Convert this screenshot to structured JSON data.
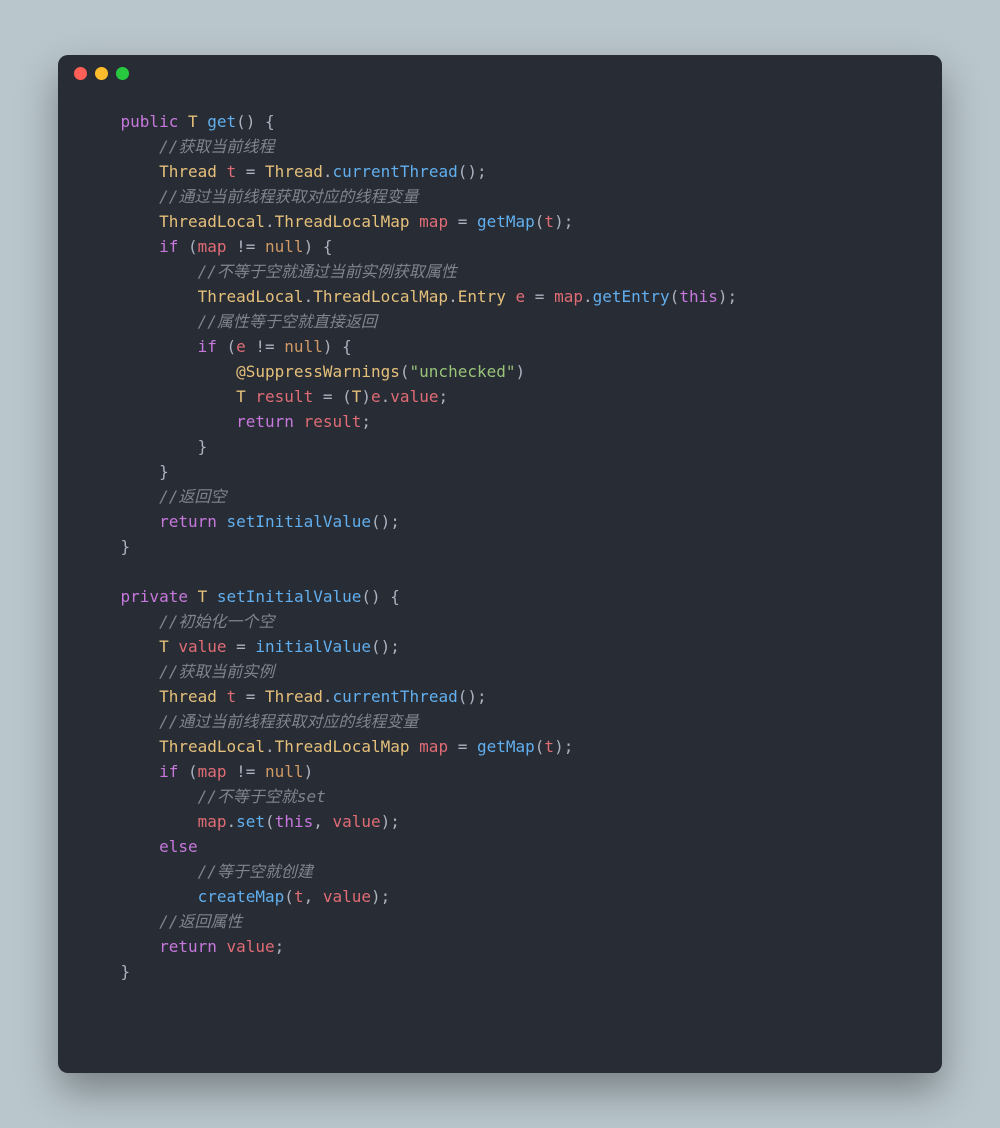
{
  "window": {
    "traffic_lights": [
      "red",
      "yellow",
      "green"
    ]
  },
  "code": {
    "lines": [
      {
        "ind": 1,
        "type": "mixed",
        "tokens": [
          {
            "c": "kw",
            "t": "public"
          },
          {
            "c": "pn",
            "t": " "
          },
          {
            "c": "type",
            "t": "T"
          },
          {
            "c": "pn",
            "t": " "
          },
          {
            "c": "fn",
            "t": "get"
          },
          {
            "c": "pn",
            "t": "() {"
          }
        ]
      },
      {
        "ind": 2,
        "type": "cmt",
        "text": "//获取当前线程"
      },
      {
        "ind": 2,
        "type": "mixed",
        "tokens": [
          {
            "c": "type",
            "t": "Thread"
          },
          {
            "c": "pn",
            "t": " "
          },
          {
            "c": "id",
            "t": "t"
          },
          {
            "c": "pn",
            "t": " = "
          },
          {
            "c": "type",
            "t": "Thread"
          },
          {
            "c": "pn",
            "t": "."
          },
          {
            "c": "fn",
            "t": "currentThread"
          },
          {
            "c": "pn",
            "t": "();"
          }
        ]
      },
      {
        "ind": 2,
        "type": "cmt",
        "text": "//通过当前线程获取对应的线程变量"
      },
      {
        "ind": 2,
        "type": "mixed",
        "tokens": [
          {
            "c": "type",
            "t": "ThreadLocal"
          },
          {
            "c": "pn",
            "t": "."
          },
          {
            "c": "type",
            "t": "ThreadLocalMap"
          },
          {
            "c": "pn",
            "t": " "
          },
          {
            "c": "id",
            "t": "map"
          },
          {
            "c": "pn",
            "t": " = "
          },
          {
            "c": "fn",
            "t": "getMap"
          },
          {
            "c": "pn",
            "t": "("
          },
          {
            "c": "id",
            "t": "t"
          },
          {
            "c": "pn",
            "t": ");"
          }
        ]
      },
      {
        "ind": 2,
        "type": "mixed",
        "tokens": [
          {
            "c": "kw",
            "t": "if"
          },
          {
            "c": "pn",
            "t": " ("
          },
          {
            "c": "id",
            "t": "map"
          },
          {
            "c": "pn",
            "t": " != "
          },
          {
            "c": "null",
            "t": "null"
          },
          {
            "c": "pn",
            "t": ") {"
          }
        ]
      },
      {
        "ind": 3,
        "type": "cmt",
        "text": "//不等于空就通过当前实例获取属性"
      },
      {
        "ind": 3,
        "type": "mixed",
        "tokens": [
          {
            "c": "type",
            "t": "ThreadLocal"
          },
          {
            "c": "pn",
            "t": "."
          },
          {
            "c": "type",
            "t": "ThreadLocalMap"
          },
          {
            "c": "pn",
            "t": "."
          },
          {
            "c": "type",
            "t": "Entry"
          },
          {
            "c": "pn",
            "t": " "
          },
          {
            "c": "id",
            "t": "e"
          },
          {
            "c": "pn",
            "t": " = "
          },
          {
            "c": "id",
            "t": "map"
          },
          {
            "c": "pn",
            "t": "."
          },
          {
            "c": "fn",
            "t": "getEntry"
          },
          {
            "c": "pn",
            "t": "("
          },
          {
            "c": "kw",
            "t": "this"
          },
          {
            "c": "pn",
            "t": ");"
          }
        ]
      },
      {
        "ind": 3,
        "type": "cmt",
        "text": "//属性等于空就直接返回"
      },
      {
        "ind": 3,
        "type": "mixed",
        "tokens": [
          {
            "c": "kw",
            "t": "if"
          },
          {
            "c": "pn",
            "t": " ("
          },
          {
            "c": "id",
            "t": "e"
          },
          {
            "c": "pn",
            "t": " != "
          },
          {
            "c": "null",
            "t": "null"
          },
          {
            "c": "pn",
            "t": ") {"
          }
        ]
      },
      {
        "ind": 4,
        "type": "mixed",
        "tokens": [
          {
            "c": "ann",
            "t": "@SuppressWarnings"
          },
          {
            "c": "pn",
            "t": "("
          },
          {
            "c": "str",
            "t": "\"unchecked\""
          },
          {
            "c": "pn",
            "t": ")"
          }
        ]
      },
      {
        "ind": 4,
        "type": "mixed",
        "tokens": [
          {
            "c": "type",
            "t": "T"
          },
          {
            "c": "pn",
            "t": " "
          },
          {
            "c": "id",
            "t": "result"
          },
          {
            "c": "pn",
            "t": " = ("
          },
          {
            "c": "type",
            "t": "T"
          },
          {
            "c": "pn",
            "t": ")"
          },
          {
            "c": "id",
            "t": "e"
          },
          {
            "c": "pn",
            "t": "."
          },
          {
            "c": "id",
            "t": "value"
          },
          {
            "c": "pn",
            "t": ";"
          }
        ]
      },
      {
        "ind": 4,
        "type": "mixed",
        "tokens": [
          {
            "c": "kw",
            "t": "return"
          },
          {
            "c": "pn",
            "t": " "
          },
          {
            "c": "id",
            "t": "result"
          },
          {
            "c": "pn",
            "t": ";"
          }
        ]
      },
      {
        "ind": 3,
        "type": "mixed",
        "tokens": [
          {
            "c": "pn",
            "t": "}"
          }
        ]
      },
      {
        "ind": 2,
        "type": "mixed",
        "tokens": [
          {
            "c": "pn",
            "t": "}"
          }
        ]
      },
      {
        "ind": 2,
        "type": "cmt",
        "text": "//返回空"
      },
      {
        "ind": 2,
        "type": "mixed",
        "tokens": [
          {
            "c": "kw",
            "t": "return"
          },
          {
            "c": "pn",
            "t": " "
          },
          {
            "c": "fn",
            "t": "setInitialValue"
          },
          {
            "c": "pn",
            "t": "();"
          }
        ]
      },
      {
        "ind": 1,
        "type": "mixed",
        "tokens": [
          {
            "c": "pn",
            "t": "}"
          }
        ]
      },
      {
        "ind": 0,
        "type": "blank"
      },
      {
        "ind": 1,
        "type": "mixed",
        "tokens": [
          {
            "c": "kw",
            "t": "private"
          },
          {
            "c": "pn",
            "t": " "
          },
          {
            "c": "type",
            "t": "T"
          },
          {
            "c": "pn",
            "t": " "
          },
          {
            "c": "fn",
            "t": "setInitialValue"
          },
          {
            "c": "pn",
            "t": "() {"
          }
        ]
      },
      {
        "ind": 2,
        "type": "cmt",
        "text": "//初始化一个空"
      },
      {
        "ind": 2,
        "type": "mixed",
        "tokens": [
          {
            "c": "type",
            "t": "T"
          },
          {
            "c": "pn",
            "t": " "
          },
          {
            "c": "id",
            "t": "value"
          },
          {
            "c": "pn",
            "t": " = "
          },
          {
            "c": "fn",
            "t": "initialValue"
          },
          {
            "c": "pn",
            "t": "();"
          }
        ]
      },
      {
        "ind": 2,
        "type": "cmt",
        "text": "//获取当前实例"
      },
      {
        "ind": 2,
        "type": "mixed",
        "tokens": [
          {
            "c": "type",
            "t": "Thread"
          },
          {
            "c": "pn",
            "t": " "
          },
          {
            "c": "id",
            "t": "t"
          },
          {
            "c": "pn",
            "t": " = "
          },
          {
            "c": "type",
            "t": "Thread"
          },
          {
            "c": "pn",
            "t": "."
          },
          {
            "c": "fn",
            "t": "currentThread"
          },
          {
            "c": "pn",
            "t": "();"
          }
        ]
      },
      {
        "ind": 2,
        "type": "cmt",
        "text": "//通过当前线程获取对应的线程变量"
      },
      {
        "ind": 2,
        "type": "mixed",
        "tokens": [
          {
            "c": "type",
            "t": "ThreadLocal"
          },
          {
            "c": "pn",
            "t": "."
          },
          {
            "c": "type",
            "t": "ThreadLocalMap"
          },
          {
            "c": "pn",
            "t": " "
          },
          {
            "c": "id",
            "t": "map"
          },
          {
            "c": "pn",
            "t": " = "
          },
          {
            "c": "fn",
            "t": "getMap"
          },
          {
            "c": "pn",
            "t": "("
          },
          {
            "c": "id",
            "t": "t"
          },
          {
            "c": "pn",
            "t": ");"
          }
        ]
      },
      {
        "ind": 2,
        "type": "mixed",
        "tokens": [
          {
            "c": "kw",
            "t": "if"
          },
          {
            "c": "pn",
            "t": " ("
          },
          {
            "c": "id",
            "t": "map"
          },
          {
            "c": "pn",
            "t": " != "
          },
          {
            "c": "null",
            "t": "null"
          },
          {
            "c": "pn",
            "t": ")"
          }
        ]
      },
      {
        "ind": 3,
        "type": "cmt",
        "text": "//不等于空就set"
      },
      {
        "ind": 3,
        "type": "mixed",
        "tokens": [
          {
            "c": "id",
            "t": "map"
          },
          {
            "c": "pn",
            "t": "."
          },
          {
            "c": "fn",
            "t": "set"
          },
          {
            "c": "pn",
            "t": "("
          },
          {
            "c": "kw",
            "t": "this"
          },
          {
            "c": "pn",
            "t": ", "
          },
          {
            "c": "id",
            "t": "value"
          },
          {
            "c": "pn",
            "t": ");"
          }
        ]
      },
      {
        "ind": 2,
        "type": "mixed",
        "tokens": [
          {
            "c": "kw",
            "t": "else"
          }
        ]
      },
      {
        "ind": 3,
        "type": "cmt",
        "text": "//等于空就创建"
      },
      {
        "ind": 3,
        "type": "mixed",
        "tokens": [
          {
            "c": "fn",
            "t": "createMap"
          },
          {
            "c": "pn",
            "t": "("
          },
          {
            "c": "id",
            "t": "t"
          },
          {
            "c": "pn",
            "t": ", "
          },
          {
            "c": "id",
            "t": "value"
          },
          {
            "c": "pn",
            "t": ");"
          }
        ]
      },
      {
        "ind": 2,
        "type": "cmt",
        "text": "//返回属性"
      },
      {
        "ind": 2,
        "type": "mixed",
        "tokens": [
          {
            "c": "kw",
            "t": "return"
          },
          {
            "c": "pn",
            "t": " "
          },
          {
            "c": "id",
            "t": "value"
          },
          {
            "c": "pn",
            "t": ";"
          }
        ]
      },
      {
        "ind": 1,
        "type": "mixed",
        "tokens": [
          {
            "c": "pn",
            "t": "}"
          }
        ]
      }
    ]
  }
}
